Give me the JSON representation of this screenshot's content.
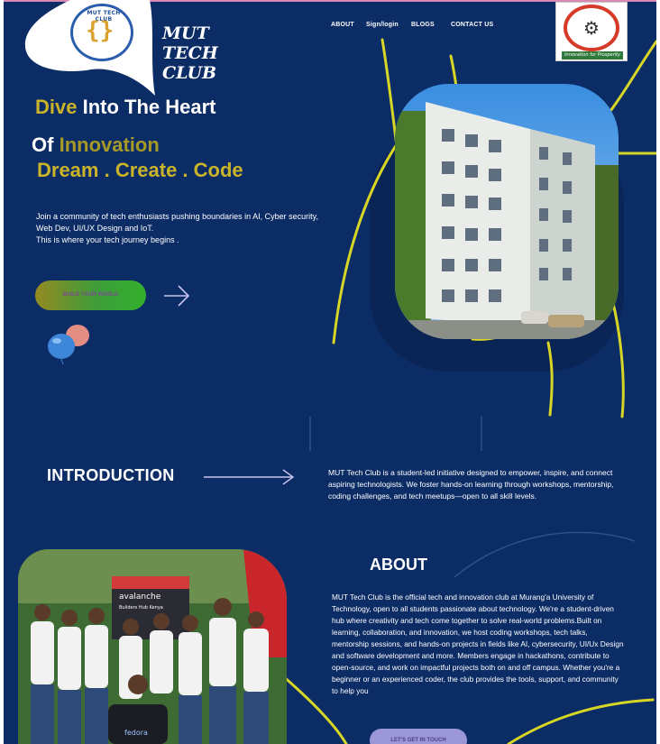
{
  "header": {
    "brand": "MUT TECH CLUB",
    "logo_text": "MUT TECH CLUB",
    "nav": [
      "ABOUT",
      "Sign/login",
      "BLOGS",
      "CONTACT US"
    ],
    "university_logo_motto": "Innovation for Prosperity"
  },
  "hero": {
    "line1_accent": "Dive",
    "line1_rest": "Into The Heart",
    "line2_prefix": "Of",
    "line2_accent": "Innovation",
    "line3": "Dream . Create . Code",
    "description_line1": "Join a community of  tech enthusiasts pushing boundaries in  AI, Cyber security,",
    "description_line2": "Web Dev, UI/UX Design and IoT.",
    "description_line3": "This is where your tech journey begins .",
    "cta_label": "BUILD YOUR WORLD"
  },
  "introduction": {
    "title": "INTRODUCTION",
    "text": "MUT Tech Club is a student-led initiative designed to empower, inspire, and connect aspiring technologists. We foster hands-on learning through workshops, mentorship, coding challenges, and tech meetups—open to all skill levels."
  },
  "about": {
    "title": "ABOUT",
    "text": "MUT Tech Club is the official tech and innovation club at Murang'a University of Technology, open to all students passionate about technology. We're a student-driven hub where creativity and tech come together to solve real-world problems.Built on learning, collaboration, and innovation, we host coding workshops, tech talks, mentorship sessions, and hands-on projects in fields like AI, cybersecurity, UI/Ux Design and software development and more. Members engage in hackathons, contribute to open-source, and work on impactful projects both on and off campus. Whether you're a beginner or an experienced coder, the club provides the tools, support, and community to help you",
    "cta_label": "LET'S GET IN TOUCH",
    "photo_banner_text": "avalanche",
    "photo_banner_sub": "Builders Hub Kenya",
    "photo_shirt_text": "fedora"
  },
  "colors": {
    "background": "#0c2c66",
    "accent_yellow": "#c9b42a",
    "line_yellow": "#d7d625",
    "cta_green": "#32b02c"
  }
}
